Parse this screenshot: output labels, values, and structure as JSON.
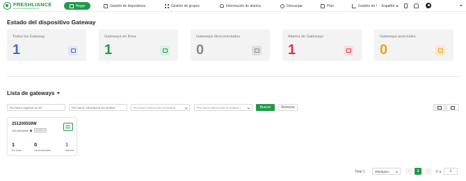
{
  "brand": {
    "name": "FRESHLIANCE",
    "tagline": "Focus on fresh and safe life only"
  },
  "nav": {
    "home": "Hogar",
    "devices": "Gestión de dispositivos",
    "groups": "Gestión de grupos",
    "alarms": "Información de alarma",
    "download": "Descargar",
    "plan": "Plan",
    "management": "Gestión de l",
    "language": "Español"
  },
  "status": {
    "title": "Estado del dispositivo Gateway",
    "cards": [
      {
        "label": "Todos los Gateway",
        "value": "1",
        "color": "#3f6fd0",
        "icon": "monitor-icon",
        "icon_bg": "#dfe7f7"
      },
      {
        "label": "Gateways en línea",
        "value": "1",
        "color": "#1f9a48",
        "icon": "wifi-icon",
        "icon_bg": "#d9f1e1"
      },
      {
        "label": "Gateways desconectados",
        "value": "0",
        "color": "#8a8a8a",
        "icon": "link-icon",
        "icon_bg": "#dedede"
      },
      {
        "label": "Alarma de Gateways",
        "value": "1",
        "color": "#e0313c",
        "icon": "warning-icon",
        "icon_bg": "#f9dcdc"
      },
      {
        "label": "Gateways anormales",
        "value": "0",
        "color": "#f2a20b",
        "icon": "alert-circle-icon",
        "icon_bg": "#fbe6cd"
      }
    ]
  },
  "list": {
    "title": "Lista de gateways",
    "filters": {
      "id_placeholder": "Por favor ingrese su ID",
      "name_placeholder": "Por favor, introduzca el nombre",
      "state_placeholder": "Por favor seleccione el estado",
      "state2_placeholder": "Por favor seleccione el estado |"
    },
    "search": "Buscar",
    "reset": "Reiniciar"
  },
  "gateway": {
    "name": "251200559W",
    "sub_id": "251200559W",
    "tag": "G1000-S",
    "online_value": "1",
    "online_label": "En línea",
    "offline_value": "0",
    "offline_label": "Desconectado",
    "alarm_value": "1",
    "alarm_label": "Alarma",
    "alarm_color": "#e0313c"
  },
  "pagination": {
    "total": "Total 1",
    "page_size": "30/página",
    "current": "1",
    "goto_label": "Ir a",
    "goto_value": "1"
  }
}
